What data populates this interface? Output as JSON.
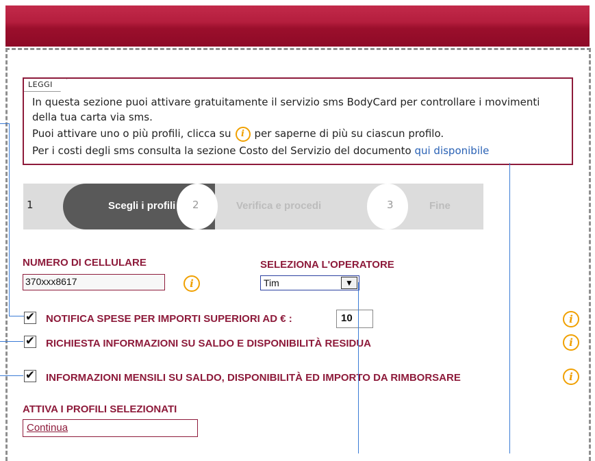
{
  "leggi": {
    "tab_label": "LEGGI",
    "line1": "In questa sezione puoi attivare gratuitamente il servizio sms BodyCard per controllare i movimenti della tua carta via sms.",
    "line2_before": "Puoi attivare uno o più profili, clicca su",
    "line2_after": "per saperne di più su ciascun profilo.",
    "line3_before": "Per i costi degli sms consulta la sezione Costo del Servizio del documento ",
    "link": "qui disponibile"
  },
  "steps": [
    {
      "number": "1",
      "label": "Scegli i profili",
      "state": "active"
    },
    {
      "number": "2",
      "label": "Verifica e procedi",
      "state": "inactive"
    },
    {
      "number": "3",
      "label": "Fine",
      "state": "inactive"
    }
  ],
  "phone": {
    "label": "NUMERO DI CELLULARE",
    "value": "370xxx8617"
  },
  "operator": {
    "label": "SELEZIONA L'OPERATORE",
    "selected": "Tim"
  },
  "options": [
    {
      "label": "NOTIFICA SPESE PER IMPORTI SUPERIORI AD € :",
      "checked": true,
      "amount": "10"
    },
    {
      "label": "RICHIESTA INFORMAZIONI SU SALDO E DISPONIBILITÀ RESIDUA",
      "checked": true
    },
    {
      "label": "INFORMAZIONI MENSILI SU SALDO, DISPONIBILITÀ ED IMPORTO DA RIMBORSARE",
      "checked": true
    }
  ],
  "activate": {
    "label": "ATTIVA I PROFILI SELEZIONATI",
    "button": "Continua"
  },
  "icons": {
    "info": "i",
    "checkmark": "✔",
    "dropdown": "▼"
  },
  "colors": {
    "brand": "#8d1a3a",
    "header": "#9b0f2c",
    "info": "#f0a000",
    "link": "#2a62b5"
  }
}
